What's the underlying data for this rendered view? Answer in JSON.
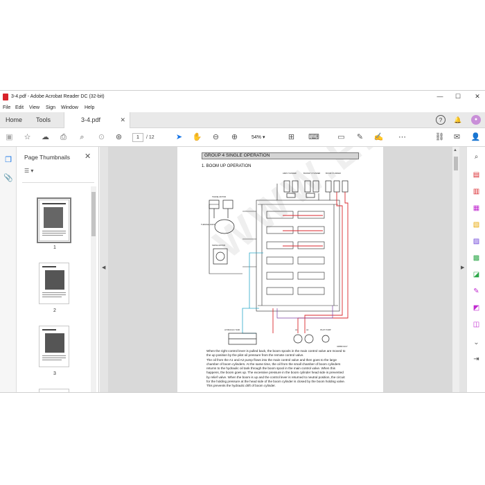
{
  "window": {
    "title": "3-4.pdf - Adobe Acrobat Reader DC (32-bit)",
    "controls": {
      "minimize": "—",
      "maximize": "☐",
      "close": "✕"
    }
  },
  "menu": [
    "File",
    "Edit",
    "View",
    "Sign",
    "Window",
    "Help"
  ],
  "tabs": {
    "home": "Home",
    "tools": "Tools",
    "doc": "3-4.pdf",
    "doc_close": "✕"
  },
  "toolbar": {
    "current_page": "1",
    "page_total": "/ 12",
    "zoom": "54%"
  },
  "thumbnails": {
    "title": "Page Thumbnails",
    "close": "✕",
    "options": "☰ ▾",
    "items": [
      {
        "label": "1"
      },
      {
        "label": "2"
      },
      {
        "label": "3"
      }
    ]
  },
  "document": {
    "group_header": "GROUP 4   SINGLE OPERATION",
    "section_title": "1. BOOM UP OPERATION",
    "figure_id": "3Z8BF0107",
    "watermark": "WWW.EPCATALOGS.COM",
    "labels": {
      "arm_cyl": "ARM CYLINDER",
      "bucket_cyl": "BUCKET CYLINDER",
      "boom_cyl": "BOOM CYLINDER",
      "left_motor": "TRAVEL MOTOR",
      "turning_joint": "TURNING JOINT",
      "swing_motor": "SWING MOTOR",
      "hyd_tank": "HYDRAULIC TANK",
      "pump_a1": "A1",
      "pump_a2": "A2",
      "pilot_pump": "PILOT PUMP"
    },
    "body_lines": [
      "When the right control lever is pulled back, the boom spools in the main control valve are moved to",
      "the up position by the pilot oil pressure from the remote control valve.",
      "The oil from the A1 and A2 pump flows into the main control valve and then goes to the large",
      "chamber of boom cylinders.  At the same time, the oil from the small chamber of boom cylinders",
      "returns to the hydraulic oil tank through the boom spool in the main control valve.  When this",
      "happens, the boom goes up.  The excessive pressure in the boom cylinder head side is prevented",
      "by relief valve.  When the boom is up and the control lever is returned to neutral position, the circuit",
      "for the holding pressure at the head side of the boom cylinder is closed by the boom holding valve.",
      "This prevents the hydraulic drift of boom cylinder."
    ]
  },
  "colors": {
    "accent": "#1473e6",
    "acrobat_red": "#d8222a",
    "high_pressure": "#d9262b",
    "return_line": "#2aa7c9",
    "pilot_line": "#7a3fa0"
  }
}
